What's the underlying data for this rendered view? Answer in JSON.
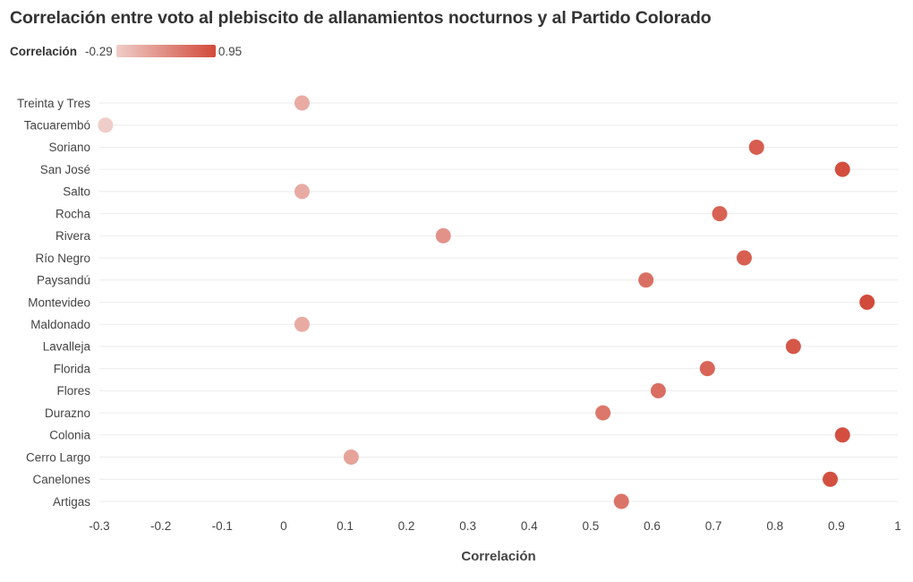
{
  "chart_data": {
    "type": "scatter",
    "subtype": "dot-plot",
    "title": "Correlación entre voto al plebiscito de allanamientos nocturnos y al Partido Colorado",
    "xlabel": "Correlación",
    "ylabel": "",
    "xlim": [
      -0.3,
      1.0
    ],
    "xticks": [
      "-0.3",
      "-0.2",
      "-0.1",
      "0",
      "0.1",
      "0.2",
      "0.3",
      "0.4",
      "0.5",
      "0.6",
      "0.7",
      "0.8",
      "0.9",
      "1"
    ],
    "xtick_values": [
      -0.3,
      -0.2,
      -0.1,
      0,
      0.1,
      0.2,
      0.3,
      0.4,
      0.5,
      0.6,
      0.7,
      0.8,
      0.9,
      1.0
    ],
    "grid": "horizontal",
    "legend": {
      "title": "Correlación",
      "min_label": "-0.29",
      "max_label": "0.95",
      "min": -0.29,
      "max": 0.95,
      "color_min": "#efcdc8",
      "color_max": "#d24a3a",
      "placement": "top-left"
    },
    "categories": [
      "Treinta y Tres",
      "Tacuarembó",
      "Soriano",
      "San José",
      "Salto",
      "Rocha",
      "Rivera",
      "Río Negro",
      "Paysandú",
      "Montevideo",
      "Maldonado",
      "Lavalleja",
      "Florida",
      "Flores",
      "Durazno",
      "Colonia",
      "Cerro Largo",
      "Canelones",
      "Artigas"
    ],
    "values": [
      0.03,
      -0.29,
      0.77,
      0.91,
      0.03,
      0.71,
      0.26,
      0.75,
      0.59,
      0.95,
      0.03,
      0.83,
      0.69,
      0.61,
      0.52,
      0.91,
      0.11,
      0.89,
      0.55
    ]
  }
}
